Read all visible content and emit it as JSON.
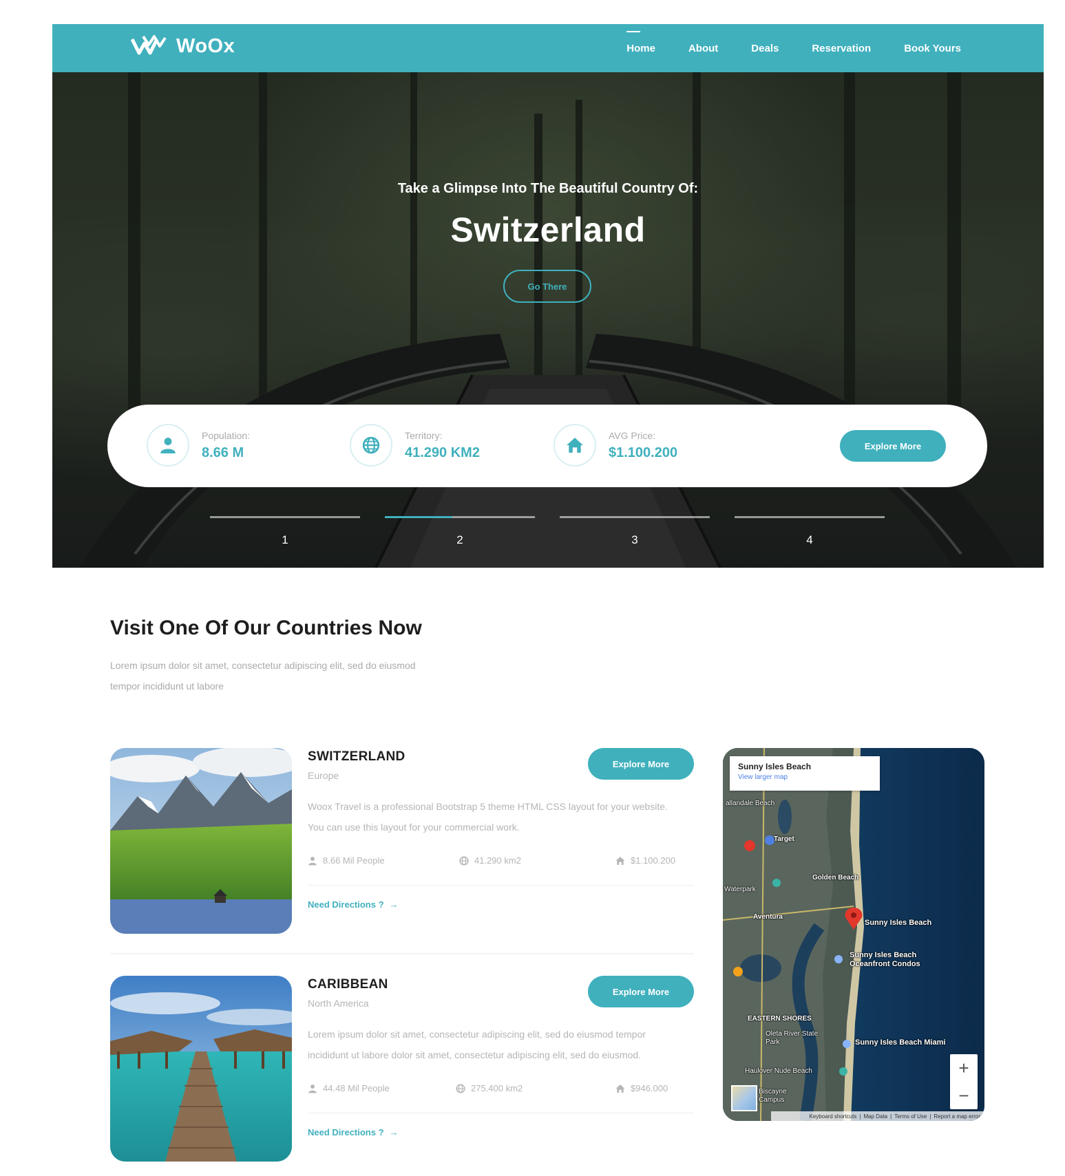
{
  "brand": {
    "name": "WoOx",
    "accent": "#40b0bd"
  },
  "nav": {
    "items": [
      {
        "label": "Home",
        "active": true
      },
      {
        "label": "About",
        "active": false
      },
      {
        "label": "Deals",
        "active": false
      },
      {
        "label": "Reservation",
        "active": false
      },
      {
        "label": "Book Yours",
        "active": false
      }
    ]
  },
  "hero": {
    "subtitle": "Take a Glimpse Into The Beautiful Country Of:",
    "title": "Switzerland",
    "go_label": "Go There",
    "stats": [
      {
        "label": "Population:",
        "value": "8.66 M",
        "icon": "user-icon"
      },
      {
        "label": "Territory:",
        "value": "41.290 KM2",
        "icon": "globe-icon"
      },
      {
        "label": "AVG Price:",
        "value": "$1.100.200",
        "icon": "home-icon"
      }
    ],
    "explore_label": "Explore More",
    "slides": [
      "1",
      "2",
      "3",
      "4"
    ],
    "active_slide": 2,
    "active_slide_progress": 0.45
  },
  "section": {
    "title": "Visit One Of Our Countries Now",
    "description": "Lorem ipsum dolor sit amet, consectetur adipiscing elit, sed do eiusmod tempor incididunt ut labore"
  },
  "countries": [
    {
      "name": "SWITZERLAND",
      "region": "Europe",
      "explore_label": "Explore More",
      "text": "Woox Travel is a professional Bootstrap 5 theme HTML CSS layout for your website. You can use this layout for your commercial work.",
      "people": "8.66 Mil People",
      "area": "41.290 km2",
      "price": "$1.100.200",
      "directions": "Need Directions ?"
    },
    {
      "name": "CARIBBEAN",
      "region": "North America",
      "explore_label": "Explore More",
      "text": "Lorem ipsum dolor sit amet, consectetur adipiscing elit, sed do eiusmod tempor incididunt ut labore dolor sit amet, consectetur adipiscing elit, sed do eiusmod.",
      "people": "44.48 Mil People",
      "area": "275.400 km2",
      "price": "$946.000",
      "directions": "Need Directions ?"
    }
  ],
  "map": {
    "place": "Sunny Isles Beach",
    "larger_link": "View larger map",
    "labels": {
      "l1": "Sunny Isles Beach",
      "l2": "Sunny Isles Beach Oceanfront Condos",
      "l3": "Sunny Isles Beach Miami",
      "l4": "Golden Beach",
      "l5": "Aventura",
      "l6": "EASTERN SHORES",
      "l7": "Oleta River State Park",
      "l8": "Haulover Nude Beach",
      "l9": "Target",
      "l10": "Waterpark",
      "l11": "Biscayne Campus",
      "l12": "allandale Beach"
    },
    "footer": [
      "Keyboard shortcuts",
      "Map Data",
      "Terms of Use",
      "Report a map error"
    ],
    "zoom_in": "+",
    "zoom_out": "−"
  }
}
